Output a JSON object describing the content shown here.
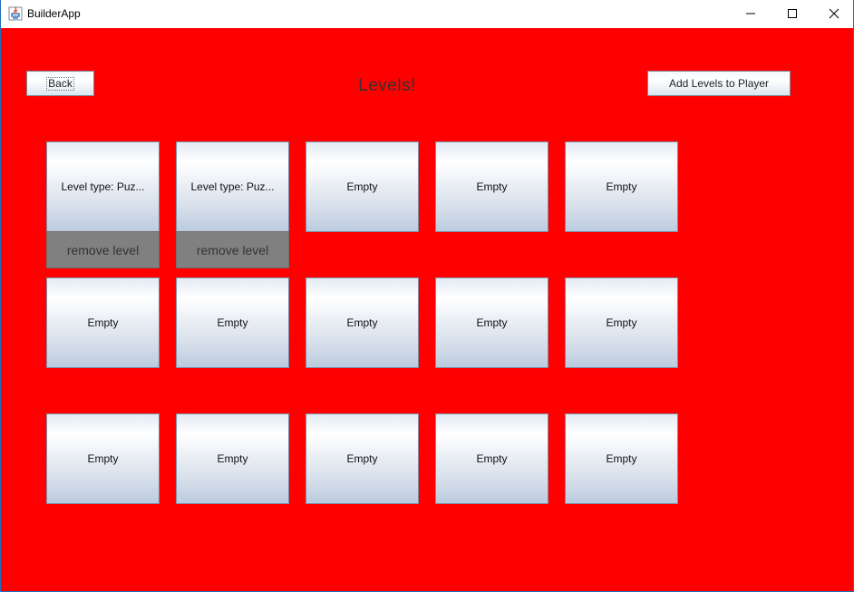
{
  "window": {
    "title": "BuilderApp",
    "icon": "java-coffee-cup-icon",
    "controls": [
      "minimize-icon",
      "maximize-icon",
      "close-icon"
    ]
  },
  "colors": {
    "background": "#ff0000",
    "remove_button": "#808080"
  },
  "toolbar": {
    "back_label": "Back",
    "heading": "Levels!",
    "add_label": "Add Levels to Player"
  },
  "grid": {
    "row1": [
      {
        "label": "Level type: Puz...",
        "remove_label": "remove level"
      },
      {
        "label": "Level type: Puz...",
        "remove_label": "remove level"
      },
      {
        "label": "Empty"
      },
      {
        "label": "Empty"
      },
      {
        "label": "Empty"
      }
    ],
    "row2": [
      {
        "label": "Empty"
      },
      {
        "label": "Empty"
      },
      {
        "label": "Empty"
      },
      {
        "label": "Empty"
      },
      {
        "label": "Empty"
      }
    ],
    "row3": [
      {
        "label": "Empty"
      },
      {
        "label": "Empty"
      },
      {
        "label": "Empty"
      },
      {
        "label": "Empty"
      },
      {
        "label": "Empty"
      }
    ]
  }
}
